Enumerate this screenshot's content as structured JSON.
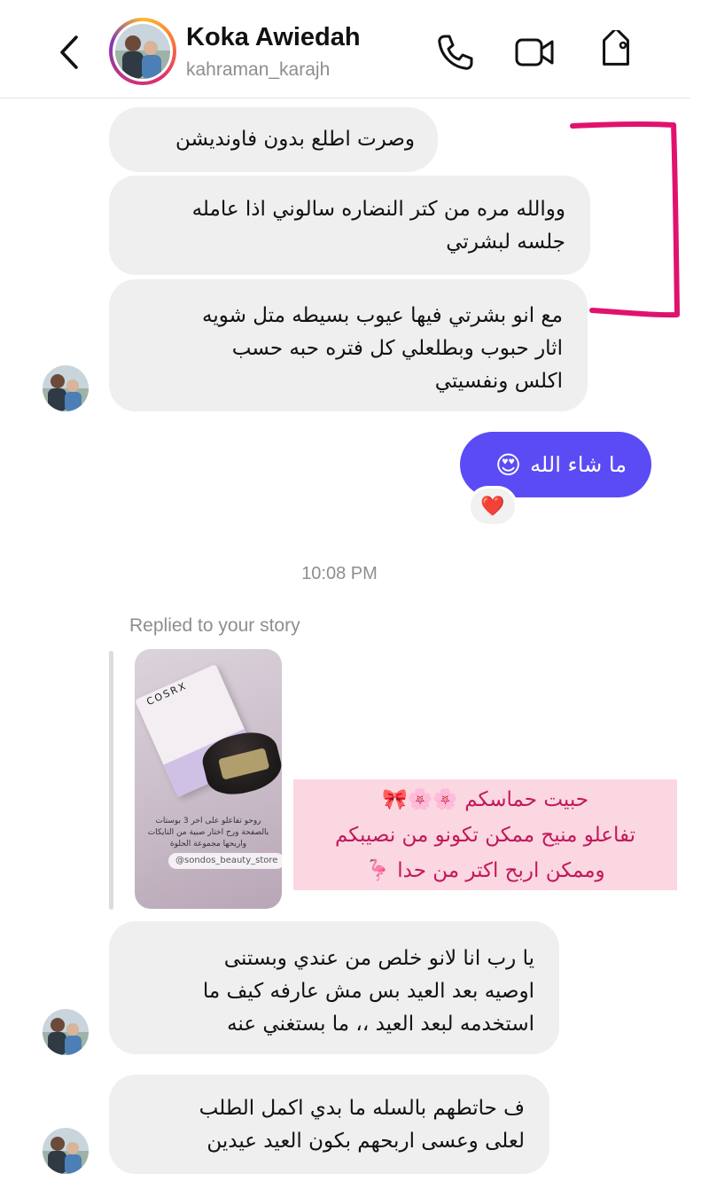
{
  "header": {
    "name": "Koka Awiedah",
    "handle": "kahraman_karajh",
    "back_icon": "chevron-left-icon",
    "call_icon": "phone-icon",
    "video_icon": "video-camera-icon",
    "tag_icon": "tag-icon"
  },
  "messages_top": {
    "m1": "وصرت اطلع بدون فاونديشن",
    "m2_l1": "ووالله مره من كتر النضاره سالوني اذا عامله",
    "m2_l2": "جلسه لبشرتي",
    "m3_l1": "مع انو بشرتي فيها عيوب بسيطه متل شويه",
    "m3_l2": "اثار حبوب وبطلعلي كل فتره حبه حسب",
    "m3_l3": "اكلس ونفسيتي"
  },
  "sent": {
    "text": "ما شاء الله",
    "emoji": "😍",
    "reaction": "❤️"
  },
  "timestamp": "10:08 PM",
  "reply": {
    "label": "Replied to your story",
    "story_brand": "COSRX",
    "story_caption": "روحو تفاعلو على اخر 3 بوستات بالصفحة ورح اختار صبية من التايكات واربحها مجموعة الحلوة",
    "story_tag": "@sondos_beauty_store"
  },
  "pink_note": {
    "l1": "حبيت حماسكم 🌸🌸🎀",
    "l2": "تفاعلو منيح ممكن تكونو من نصيبكم",
    "l3": "وممكن اربح اكتر من حدا 🦩"
  },
  "messages_bottom": {
    "m4_l1": "يا رب انا لانو خلص من عندي وبستنى",
    "m4_l2": "اوصيه بعد العيد بس مش عارفه كيف ما",
    "m4_l3": "استخدمه لبعد العيد ،، ما بستغني عنه",
    "m5_l1": "ف حاتطهم بالسله ما بدي اكمل الطلب",
    "m5_l2": "لعلى وعسى اربحهم بكون العيد عيدين"
  },
  "colors": {
    "sent_bubble": "#5b4bf5",
    "received_bubble": "#efefef",
    "annotation": "#e0126e",
    "pink_note_bg": "#fbd7e1",
    "pink_note_text": "#c2185b"
  }
}
